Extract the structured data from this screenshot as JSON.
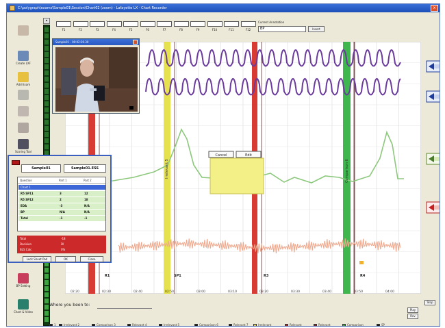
{
  "app": {
    "title": "C:\\polygraph\\exams\\Sample01\\Session\\Chart02 (zoom) - Lafayette LX - Chart Recorder",
    "close_label": "x"
  },
  "toolbar": {
    "items": [
      {
        "label": "",
        "icon": "record-icon",
        "color": "#c8b8a8"
      },
      {
        "label": "Create LXF",
        "icon": "create-file-icon",
        "color": "#6c8ab8"
      },
      {
        "label": "Add Exam",
        "icon": "folder-icon",
        "color": "#e8c040"
      },
      {
        "label": "",
        "icon": "document-icon",
        "color": "#b8b8b0"
      },
      {
        "label": "",
        "icon": "settings-icon",
        "color": "#c0b8b0"
      },
      {
        "label": "",
        "icon": "tools-icon",
        "color": "#b0a8a0"
      },
      {
        "label": "Scoring Tool",
        "icon": "scoring-icon",
        "color": "#505060"
      },
      {
        "label": "BP Setting",
        "icon": "bp-setting-icon",
        "color": "#c83c5c"
      },
      {
        "label": "Chart & Video",
        "icon": "chart-video-icon",
        "color": "#28806c"
      }
    ]
  },
  "channels": {
    "labels": [
      "F1",
      "F2",
      "F3",
      "F4",
      "F5",
      "F6",
      "F7",
      "F8",
      "F9",
      "F10",
      "F11",
      "F12"
    ]
  },
  "comment": {
    "label": "Current Annotation",
    "value": "BP",
    "button": "Insert"
  },
  "chart": {
    "time_labels": [
      "02:20",
      "02:30",
      "02:40",
      "02:50",
      "03:00",
      "03:10",
      "03:20",
      "03:30",
      "03:40",
      "03:50",
      "04:00"
    ],
    "annotation_markers": [
      "R1",
      "SP1",
      "R3",
      "R4"
    ],
    "vertical_labels": [
      "Irrelevant 5",
      "Comparison 6"
    ],
    "marker_popup": {
      "button1": "Cancel",
      "button2": "Edit"
    }
  },
  "video": {
    "title": "Sample01 - 00:02:20.30",
    "stop_icon": "stop-icon"
  },
  "panel": {
    "tab1": "Sample01",
    "tab2": "Sample01.ESS",
    "headers": [
      "Question",
      "Part 1",
      "Part 2"
    ],
    "selected": "Chart 1",
    "rows": [
      [
        "R5 SP11",
        "3",
        "12"
      ],
      [
        "R5 SP12",
        "2",
        "18"
      ],
      [
        "EDA",
        "-3",
        "N/A"
      ],
      [
        "BP",
        "N/A",
        "N/A"
      ],
      [
        "Total",
        "-1",
        "-1"
      ]
    ],
    "red_rows": [
      [
        "Total",
        "-18"
      ],
      [
        "Decision",
        "DI"
      ],
      [
        "BLS Calc",
        "0%"
      ]
    ],
    "buttons": [
      "Lock Sheet Pad",
      "OK",
      "Close"
    ]
  },
  "bottom": {
    "where_label": "Where you been to:"
  },
  "legend": {
    "items": [
      {
        "label": "1",
        "color": "#1a1a1a"
      },
      {
        "label": "Irrelevant 2",
        "color": "#1a1a1a"
      },
      {
        "label": "Comparison 3",
        "color": "#1a1a1a"
      },
      {
        "label": "Relevant 4",
        "color": "#1a1a1a"
      },
      {
        "label": "Irrelevant 5",
        "color": "#1a1a1a"
      },
      {
        "label": "Comparison 6",
        "color": "#1a1a1a"
      },
      {
        "label": "Relevant 7",
        "color": "#1a1a1a"
      },
      {
        "label": "Irrelevant",
        "color": "#e8d030"
      },
      {
        "label": "Relevant",
        "color": "#c02020"
      },
      {
        "label": "Relevant",
        "color": "#902020"
      },
      {
        "label": "Comparison",
        "color": "#30b030"
      },
      {
        "label": "SP",
        "color": "#1a1a1a"
      }
    ]
  },
  "small_buttons": {
    "b1": "Stop",
    "b2": "Play",
    "b3": "Rev"
  },
  "colors": {
    "pneumo": "#6a3a9c",
    "eda": "#8cc87c",
    "cardio": "#f0a88c",
    "irrelevant_bar": "#e4e040",
    "relevant_bar": "#d42a22",
    "comparison_bar": "#30b040"
  }
}
